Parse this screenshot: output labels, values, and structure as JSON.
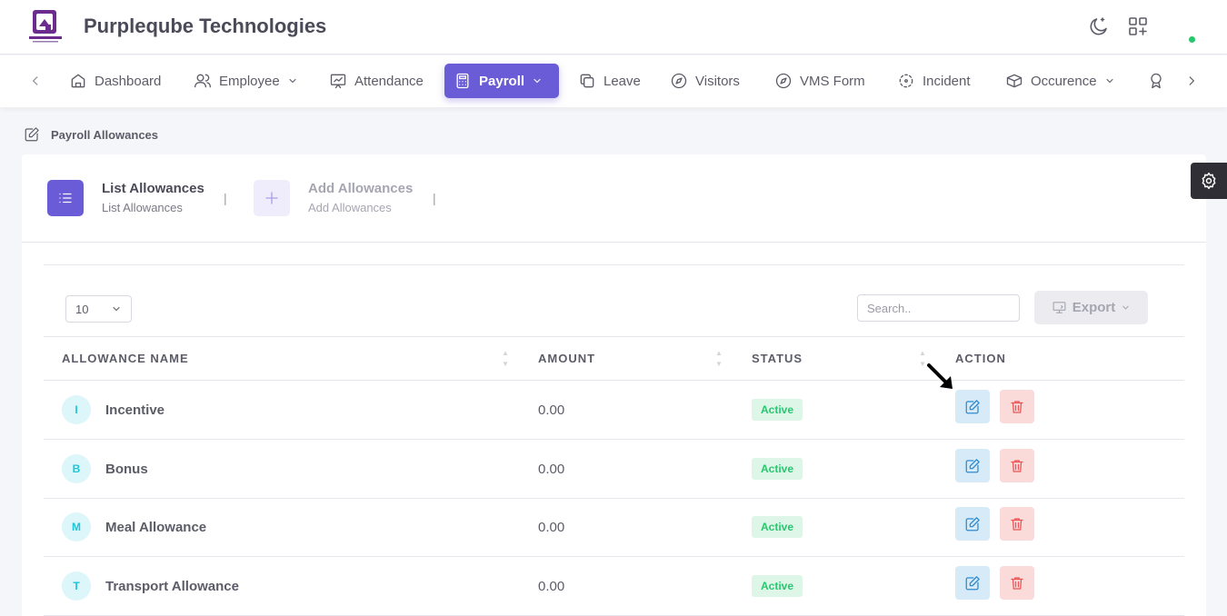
{
  "company": {
    "name": "Purpleqube Technologies"
  },
  "nav": {
    "items": [
      {
        "label": "Dashboard",
        "icon": "home-icon"
      },
      {
        "label": "Employee",
        "icon": "users-icon"
      },
      {
        "label": "Attendance",
        "icon": "presentation-icon"
      },
      {
        "label": "Payroll",
        "icon": "calculator-icon",
        "active": true
      },
      {
        "label": "Leave",
        "icon": "copy-icon"
      },
      {
        "label": "Visitors",
        "icon": "compass-icon"
      },
      {
        "label": "VMS Form",
        "icon": "compass-icon"
      },
      {
        "label": "Incident",
        "icon": "focus-icon"
      },
      {
        "label": "Occurence",
        "icon": "box-icon"
      }
    ]
  },
  "breadcrumb": {
    "label": "Payroll Allowances"
  },
  "stepper": {
    "list_title": "List Allowances",
    "list_sub": "List Allowances",
    "add_title": "Add Allowances",
    "add_sub": "Add Allowances",
    "separator": "|"
  },
  "table": {
    "page_length": "10",
    "search_placeholder": "Search..",
    "export_label": "Export",
    "headers": [
      "ALLOWANCE NAME",
      "AMOUNT",
      "STATUS",
      "ACTION"
    ],
    "rows": [
      {
        "initial": "I",
        "name": "Incentive",
        "amount": "0.00",
        "status": "Active"
      },
      {
        "initial": "B",
        "name": "Bonus",
        "amount": "0.00",
        "status": "Active"
      },
      {
        "initial": "M",
        "name": "Meal Allowance",
        "amount": "0.00",
        "status": "Active"
      },
      {
        "initial": "T",
        "name": "Transport Allowance",
        "amount": "0.00",
        "status": "Active"
      }
    ]
  },
  "colors": {
    "accent": "#6a5cd6",
    "success": "#28c76f",
    "danger": "#ea5455",
    "info": "#00cfe8"
  }
}
